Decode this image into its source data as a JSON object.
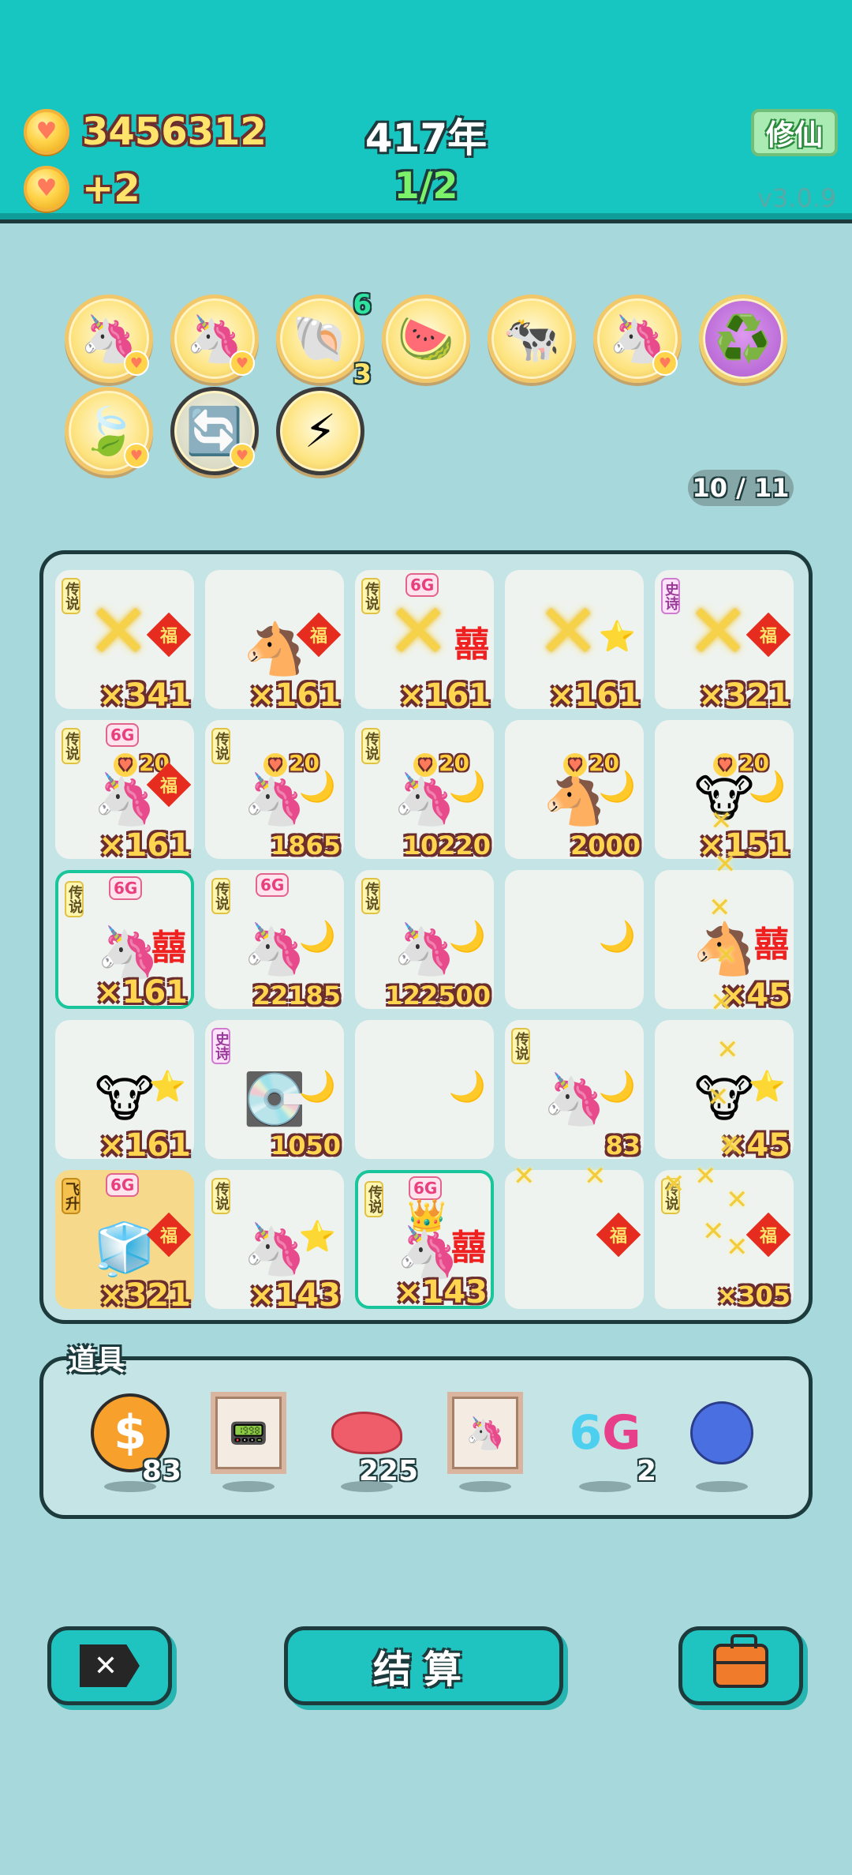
{
  "header": {
    "coins": "3456312",
    "coin_rate": "+2",
    "year": "417年",
    "progress": "1/2",
    "xiuxian_label": "修仙",
    "version": "v3.0.9"
  },
  "badges": {
    "shell_top": "6",
    "shell_bottom": "3",
    "page_indicator": "10 / 11"
  },
  "tags": {
    "legend": "传说",
    "epic": "史诗",
    "ascend": "飞升",
    "net": "6G",
    "fu": "福",
    "xi": "囍",
    "twenty": "20"
  },
  "cells": [
    {
      "count": "×341"
    },
    {
      "count": "×161"
    },
    {
      "count": "×161"
    },
    {
      "count": "×161"
    },
    {
      "count": "×321"
    },
    {
      "count": "×161"
    },
    {
      "count": "1865"
    },
    {
      "count": "10220"
    },
    {
      "count": "2000"
    },
    {
      "count": "×151"
    },
    {
      "count": "×161"
    },
    {
      "count": "22185"
    },
    {
      "count": "122500"
    },
    {
      "count": ""
    },
    {
      "count": "×45"
    },
    {
      "count": "×161"
    },
    {
      "count": "1050"
    },
    {
      "count": ""
    },
    {
      "count": "83"
    },
    {
      "count": "×45"
    },
    {
      "count": "×321"
    },
    {
      "count": "×143"
    },
    {
      "count": "×143"
    },
    {
      "count": ""
    },
    {
      "count": "×305"
    }
  ],
  "tools": {
    "title": "道具",
    "coin_qty": "83",
    "liver_qty": "225",
    "sixg_qty": "2",
    "sixg_a": "6",
    "sixg_b": "G"
  },
  "buttons": {
    "settle": "结算",
    "exit_symbol": "✕"
  },
  "colors": {
    "header_bg": "#17c6c1",
    "page_bg": "#a6d8dc",
    "board_bg": "#c5e4e5",
    "outline": "#1d3b3d",
    "gold_text": "#ffd54f"
  }
}
